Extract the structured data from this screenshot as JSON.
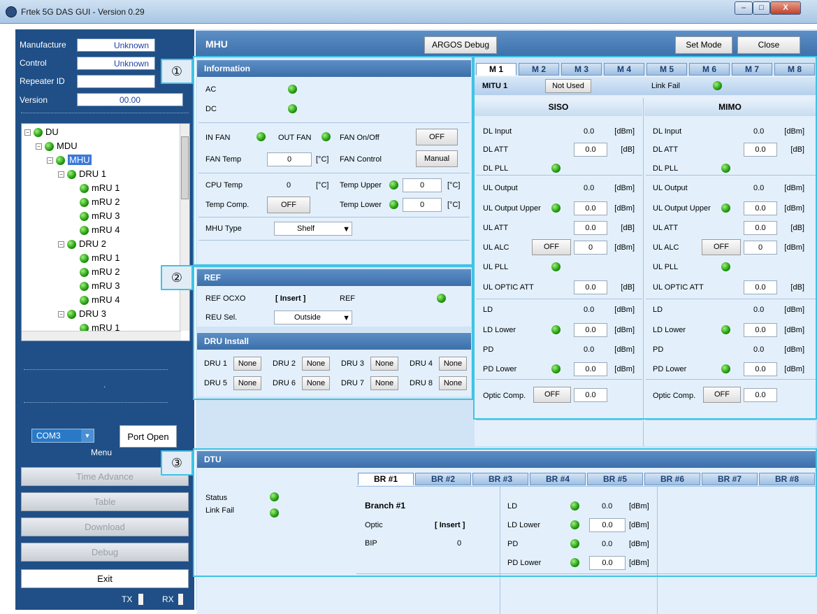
{
  "window": {
    "title": "Frtek 5G DAS GUI - Version 0.29",
    "minimize": "–",
    "maximize": "□",
    "close": "X"
  },
  "sidebar": {
    "manufacture_label": "Manufacture",
    "manufacture_value": "Unknown",
    "control_label": "Control",
    "control_value": "Unknown",
    "repeater_label": "Repeater ID",
    "repeater_value": "",
    "version_label": "Version",
    "version_value": "00.00",
    "tree": [
      "DU",
      "MDU",
      "MHU",
      "DRU 1",
      "mRU 1",
      "mRU 2",
      "mRU 3",
      "mRU 4",
      "DRU 2",
      "mRU 1",
      "mRU 2",
      "mRU 3",
      "mRU 4",
      "DRU 3",
      "mRU 1"
    ],
    "dot": ".",
    "port": "COM3",
    "port_open": "Port Open",
    "menu": "Menu",
    "menu_items": [
      "Time Advance",
      "Table",
      "Download",
      "Debug",
      "Exit"
    ],
    "tx": "TX",
    "rx": "RX"
  },
  "header": {
    "title": "MHU",
    "argos": "ARGOS Debug",
    "set_mode": "Set Mode",
    "close": "Close"
  },
  "callouts": [
    "①",
    "②",
    "③"
  ],
  "info": {
    "title": "Information",
    "ac": "AC",
    "dc": "DC",
    "in_fan": "IN FAN",
    "out_fan": "OUT FAN",
    "fan_onoff": "FAN On/Off",
    "fan_onoff_btn": "OFF",
    "fan_temp": "FAN Temp",
    "fan_temp_val": "0",
    "unit_c": "[°C]",
    "fan_control": "FAN Control",
    "fan_control_btn": "Manual",
    "cpu_temp": "CPU Temp",
    "cpu_temp_val": "0",
    "temp_upper": "Temp Upper",
    "temp_upper_val": "0",
    "temp_comp": "Temp Comp.",
    "temp_comp_btn": "OFF",
    "temp_lower": "Temp Lower",
    "temp_lower_val": "0",
    "mhu_type": "MHU Type",
    "mhu_type_val": "Shelf"
  },
  "ref": {
    "title": "REF",
    "ocxo": "REF OCXO",
    "ocxo_val": "[ Insert ]",
    "ref": "REF",
    "reu_sel": "REU Sel.",
    "reu_sel_val": "Outside"
  },
  "dru_install": {
    "title": "DRU Install",
    "items": [
      "DRU 1",
      "DRU 2",
      "DRU 3",
      "DRU 4",
      "DRU 5",
      "DRU 6",
      "DRU 7",
      "DRU 8"
    ],
    "btn": "None"
  },
  "mtabs": [
    "M 1",
    "M 2",
    "M 3",
    "M 4",
    "M 5",
    "M 6",
    "M 7",
    "M 8"
  ],
  "mitu": {
    "name": "MITU 1",
    "not_used": "Not Used",
    "link_fail": "Link Fail"
  },
  "siso_title": "SISO",
  "mimo_title": "MIMO",
  "rf": {
    "dl_input": "DL Input",
    "dl_att": "DL ATT",
    "dl_pll": "DL PLL",
    "ul_output": "UL Output",
    "ul_output_upper": "UL Output Upper",
    "ul_att": "UL ATT",
    "ul_alc": "UL ALC",
    "ul_pll": "UL PLL",
    "ul_optic_att": "UL OPTIC ATT",
    "ld": "LD",
    "ld_lower": "LD Lower",
    "pd": "PD",
    "pd_lower": "PD Lower",
    "optic_comp": "Optic Comp.",
    "off": "OFF",
    "val": "0.0",
    "zero": "0",
    "dbm": "[dBm]",
    "db": "[dB]"
  },
  "dtu": {
    "title": "DTU",
    "status": "Status",
    "link_fail": "Link Fail",
    "tabs": [
      "BR #1",
      "BR #2",
      "BR #3",
      "BR #4",
      "BR #5",
      "BR #6",
      "BR #7",
      "BR #8"
    ],
    "branch": "Branch #1",
    "optic": "Optic",
    "optic_val": "[ Insert ]",
    "bip": "BIP",
    "bip_val": "0",
    "ld": "LD",
    "ld_lower": "LD Lower",
    "pd": "PD",
    "pd_lower": "PD Lower",
    "val": "0.0",
    "dbm": "[dBm]"
  }
}
